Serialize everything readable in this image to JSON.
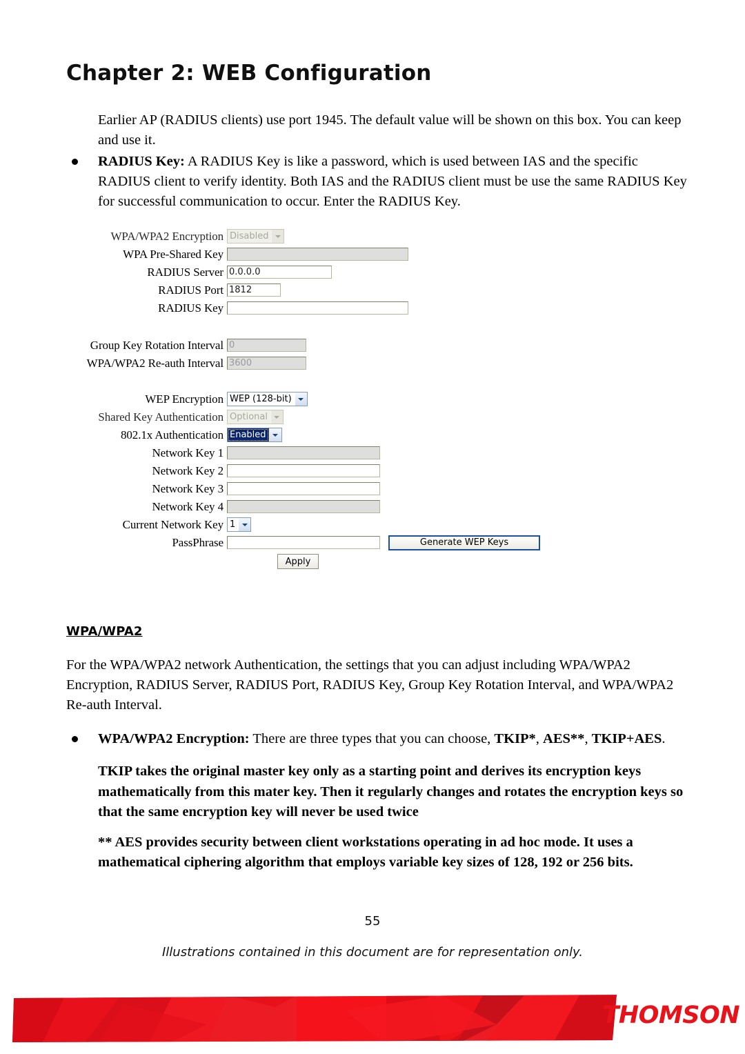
{
  "document": {
    "chapter_title": "Chapter 2: WEB Configuration",
    "page_number": "55",
    "footer_note": "Illustrations contained in this document are for representation only.",
    "brand": "THOMSON",
    "brand_color": "#e8131a",
    "banner_color": "#ed1c24"
  },
  "intro": {
    "paragraph": "Earlier AP (RADIUS clients) use port 1945. The default value will be shown on this box. You can keep and use it.",
    "bullet_term": "RADIUS Key:",
    "bullet_text": " A RADIUS Key is like a password, which is used between IAS and the specific RADIUS client to verify identity. Both IAS and the RADIUS client must be use the same RADIUS Key for successful communication to occur. Enter the RADIUS Key."
  },
  "form": {
    "rows": {
      "wpa_encryption": {
        "label": "WPA/WPA2 Encryption",
        "value": "Disabled"
      },
      "wpa_psk": {
        "label": "WPA Pre-Shared Key",
        "value": ""
      },
      "radius_server": {
        "label": "RADIUS Server",
        "value": "0.0.0.0"
      },
      "radius_port": {
        "label": "RADIUS Port",
        "value": "1812"
      },
      "radius_key": {
        "label": "RADIUS Key",
        "value": ""
      },
      "group_key_rotation": {
        "label": "Group Key Rotation Interval",
        "value": "0"
      },
      "reauth_interval": {
        "label": "WPA/WPA2 Re-auth Interval",
        "value": "3600"
      },
      "wep_encryption": {
        "label": "WEP Encryption",
        "value": "WEP (128-bit)"
      },
      "shared_key_auth": {
        "label": "Shared Key Authentication",
        "value": "Optional"
      },
      "dot1x_auth": {
        "label": "802.1x Authentication",
        "value": "Enabled"
      },
      "network_key_1": {
        "label": "Network Key 1",
        "value": ""
      },
      "network_key_2": {
        "label": "Network Key 2",
        "value": ""
      },
      "network_key_3": {
        "label": "Network Key 3",
        "value": ""
      },
      "network_key_4": {
        "label": "Network Key 4",
        "value": ""
      },
      "current_network_key": {
        "label": "Current Network Key",
        "value": "1"
      },
      "passphrase": {
        "label": "PassPhrase",
        "value": ""
      }
    },
    "buttons": {
      "generate": "Generate WEP Keys",
      "apply": "Apply"
    }
  },
  "section": {
    "heading": "WPA/WPA2",
    "paragraph": "For the WPA/WPA2 network Authentication, the settings that you can adjust including WPA/WPA2 Encryption, RADIUS Server, RADIUS Port, RADIUS Key, Group Key Rotation Interval, and WPA/WPA2 Re-auth Interval.",
    "bullet_term": "WPA/WPA2 Encryption:",
    "bullet_text_plain": " There are three types that you can choose, ",
    "bullet_opt1": "TKIP*",
    "bullet_sep1": ", ",
    "bullet_opt2": "AES**",
    "bullet_sep2": ", ",
    "bullet_opt3": "TKIP+AES",
    "bullet_end": ".",
    "note_tkip": "TKIP takes the original master key only as a starting point and derives its encryption keys mathematically from this mater key. Then it regularly changes and rotates the encryption keys so that the same encryption key will never be used twice",
    "note_aes": "** AES provides security between client workstations operating in ad hoc mode. It uses a mathematical ciphering algorithm that employs variable key sizes of 128, 192 or 256 bits."
  }
}
